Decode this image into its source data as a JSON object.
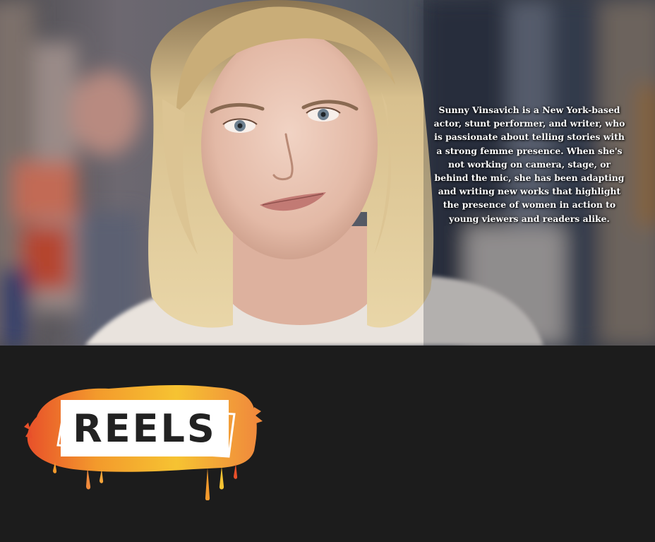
{
  "hero": {
    "photo_icon": "portrait-photo",
    "bio": "Sunny Vinsavich is a New York-based actor, stunt performer, and writer, who is passionate about telling stories with a strong femme presence. When she's not working on camera, stage, or behind the mic, she has been adapting and writing new works that highlight the presence of women in action to young viewers and readers alike."
  },
  "reels_section": {
    "heading": "REELS",
    "colors": {
      "background": "#1c1c1c",
      "paint_orange": "#f39a2c",
      "paint_red": "#e8502a",
      "paint_yellow": "#f6c332",
      "label_bg": "#ffffff",
      "label_text": "#222222"
    }
  }
}
